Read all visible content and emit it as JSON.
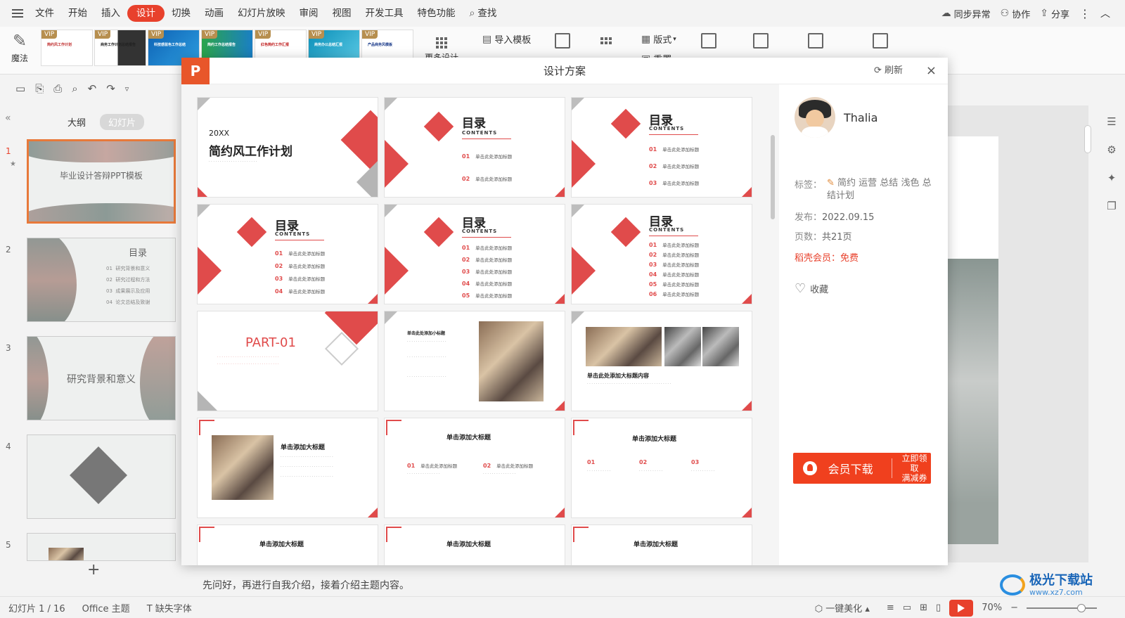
{
  "menubar": {
    "items": [
      "文件",
      "开始",
      "插入",
      "设计",
      "切换",
      "动画",
      "幻灯片放映",
      "审阅",
      "视图",
      "开发工具",
      "特色功能"
    ],
    "active_index": 3,
    "search_label": "查找",
    "sync_label": "同步异常",
    "collab_label": "协作",
    "share_label": "分享"
  },
  "ribbon": {
    "magic_label": "魔法",
    "vip_badge": "VIP",
    "templates": [
      {
        "title": "简约风工作计划"
      },
      {
        "title": "商务工作计划总结报告"
      },
      {
        "title": "科技感蓝色工作总结"
      },
      {
        "title": "简约工作总结报告"
      },
      {
        "title": "红色简约工作汇报"
      },
      {
        "title": "商务办公总结汇报"
      },
      {
        "title": "产品商务风模板"
      }
    ],
    "more_design": "更多设计",
    "import_template": "导入模板",
    "layout_label": "版式",
    "reorder_label": "重置"
  },
  "left_panel": {
    "tab_outline": "大纲",
    "tab_slides": "幻灯片",
    "slides": [
      {
        "num": "1",
        "title": "毕业设计答辩PPT模板"
      },
      {
        "num": "2",
        "title": "目录",
        "items": [
          "01",
          "研究背景和意义",
          "02",
          "研究过程和方法",
          "03",
          "成果展示及应用",
          "04",
          "论文总结及致谢"
        ]
      },
      {
        "num": "3",
        "title": "研究背景和意义"
      },
      {
        "num": "4",
        "title": ""
      },
      {
        "num": "5",
        "title": ""
      }
    ],
    "add_slide": "+"
  },
  "dialog": {
    "title": "设计方案",
    "refresh_label": "刷新",
    "close_label": "×",
    "cover": {
      "year": "20XX",
      "title": "简约风工作计划"
    },
    "toc_title": "目录",
    "toc_sub": "CONTENTS",
    "toc_item": "单击此处添加标题",
    "part_title": "PART-01",
    "add_heading": "单击此处添加大标题内容",
    "add_big_title": "单击添加大标题",
    "add_sub_title": "单击此处添加小标题",
    "toc_nums": [
      "01",
      "02",
      "03",
      "04",
      "05",
      "06"
    ]
  },
  "author_panel": {
    "name": "Thalia",
    "tags_label": "标签：",
    "tags_value": "简约 运营 总结 浅色 总结计划",
    "published_label": "发布：",
    "published_value": "2022.09.15",
    "pages_label": "页数：",
    "pages_value": "共21页",
    "vip_label": "稻壳会员：",
    "vip_value": "免费",
    "favorite_label": "收藏",
    "download_label": "会员下载",
    "coupon_line1": "立即领取",
    "coupon_line2": "满减券"
  },
  "notes": {
    "text": "先问好，再进行自我介绍，接着介绍主题内容。"
  },
  "statusbar": {
    "slide_counter": "幻灯片 1 / 16",
    "theme": "Office 主题",
    "missing_font": "缺失字体",
    "beautify": "一键美化",
    "zoom": "70%"
  },
  "watermark": {
    "name": "极光下载站",
    "url": "www.xz7.com"
  },
  "colors": {
    "accent": "#e8412c",
    "design_red": "#e04b4b",
    "vip_gold": "#b78f4f"
  }
}
